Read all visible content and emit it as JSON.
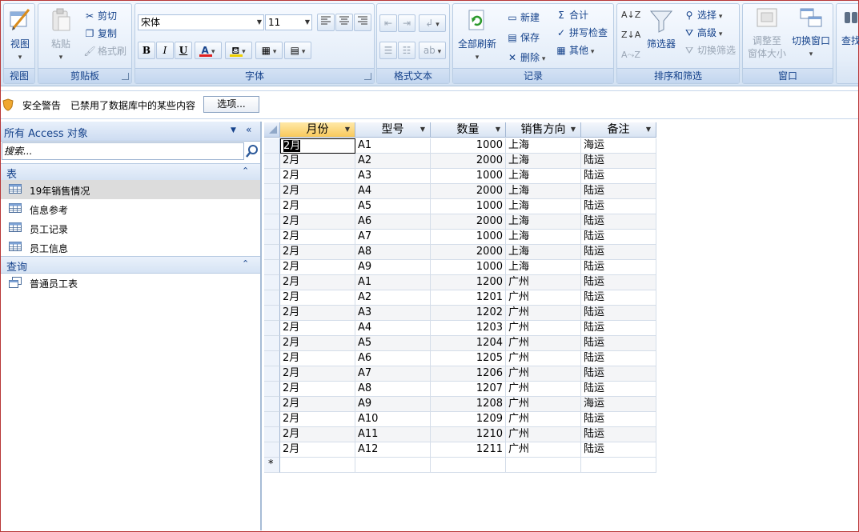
{
  "ribbon": {
    "groups": {
      "view": {
        "label": "视图",
        "button": "视图"
      },
      "clipboard": {
        "label": "剪贴板",
        "paste": "粘贴",
        "cut": "剪切",
        "copy": "复制",
        "format_painter": "格式刷"
      },
      "font": {
        "label": "字体",
        "font_name": "宋体",
        "font_size": "11",
        "bold": "B",
        "italic": "I",
        "underline": "U",
        "font_color": "A"
      },
      "rich_text": {
        "label": "格式文本"
      },
      "records": {
        "label": "记录",
        "refresh_all": "全部刷新",
        "new": "新建",
        "save": "保存",
        "delete": "删除",
        "totals": "合计",
        "spelling": "拼写检查",
        "more": "其他"
      },
      "sort_filter": {
        "label": "排序和筛选",
        "filter": "筛选器",
        "selection": "选择",
        "advanced": "高级",
        "toggle_filter": "切换筛选"
      },
      "window": {
        "label": "窗口",
        "size_to_fit": "调整至窗体大小",
        "size_to_fit_line1": "调整至",
        "size_to_fit_line2": "窗体大小",
        "switch_windows": "切换窗口"
      },
      "find": {
        "label": "查找"
      }
    }
  },
  "message_bar": {
    "title": "安全警告",
    "text": "已禁用了数据库中的某些内容",
    "options_button": "选项..."
  },
  "nav": {
    "header": "所有 Access 对象",
    "search_placeholder": "搜索...",
    "sections": [
      {
        "title": "表",
        "items": [
          "19年销售情况",
          "信息参考",
          "员工记录",
          "员工信息"
        ]
      },
      {
        "title": "查询",
        "items": [
          "普通员工表"
        ]
      }
    ]
  },
  "datasheet": {
    "columns": [
      "月份",
      "型号",
      "数量",
      "销售方向",
      "备注"
    ],
    "rows": [
      [
        "2月",
        "A1",
        "1000",
        "上海",
        "海运"
      ],
      [
        "2月",
        "A2",
        "2000",
        "上海",
        "陆运"
      ],
      [
        "2月",
        "A3",
        "1000",
        "上海",
        "陆运"
      ],
      [
        "2月",
        "A4",
        "2000",
        "上海",
        "陆运"
      ],
      [
        "2月",
        "A5",
        "1000",
        "上海",
        "陆运"
      ],
      [
        "2月",
        "A6",
        "2000",
        "上海",
        "陆运"
      ],
      [
        "2月",
        "A7",
        "1000",
        "上海",
        "陆运"
      ],
      [
        "2月",
        "A8",
        "2000",
        "上海",
        "陆运"
      ],
      [
        "2月",
        "A9",
        "1000",
        "上海",
        "陆运"
      ],
      [
        "2月",
        "A1",
        "1200",
        "广州",
        "陆运"
      ],
      [
        "2月",
        "A2",
        "1201",
        "广州",
        "陆运"
      ],
      [
        "2月",
        "A3",
        "1202",
        "广州",
        "陆运"
      ],
      [
        "2月",
        "A4",
        "1203",
        "广州",
        "陆运"
      ],
      [
        "2月",
        "A5",
        "1204",
        "广州",
        "陆运"
      ],
      [
        "2月",
        "A6",
        "1205",
        "广州",
        "陆运"
      ],
      [
        "2月",
        "A7",
        "1206",
        "广州",
        "陆运"
      ],
      [
        "2月",
        "A8",
        "1207",
        "广州",
        "陆运"
      ],
      [
        "2月",
        "A9",
        "1208",
        "广州",
        "海运"
      ],
      [
        "2月",
        "A10",
        "1209",
        "广州",
        "陆运"
      ],
      [
        "2月",
        "A11",
        "1210",
        "广州",
        "陆运"
      ],
      [
        "2月",
        "A12",
        "1211",
        "广州",
        "陆运"
      ]
    ],
    "new_row_marker": "*"
  },
  "colors": {
    "accent": "#15428b",
    "frame": "#b83838",
    "warning": "#f0a830"
  }
}
